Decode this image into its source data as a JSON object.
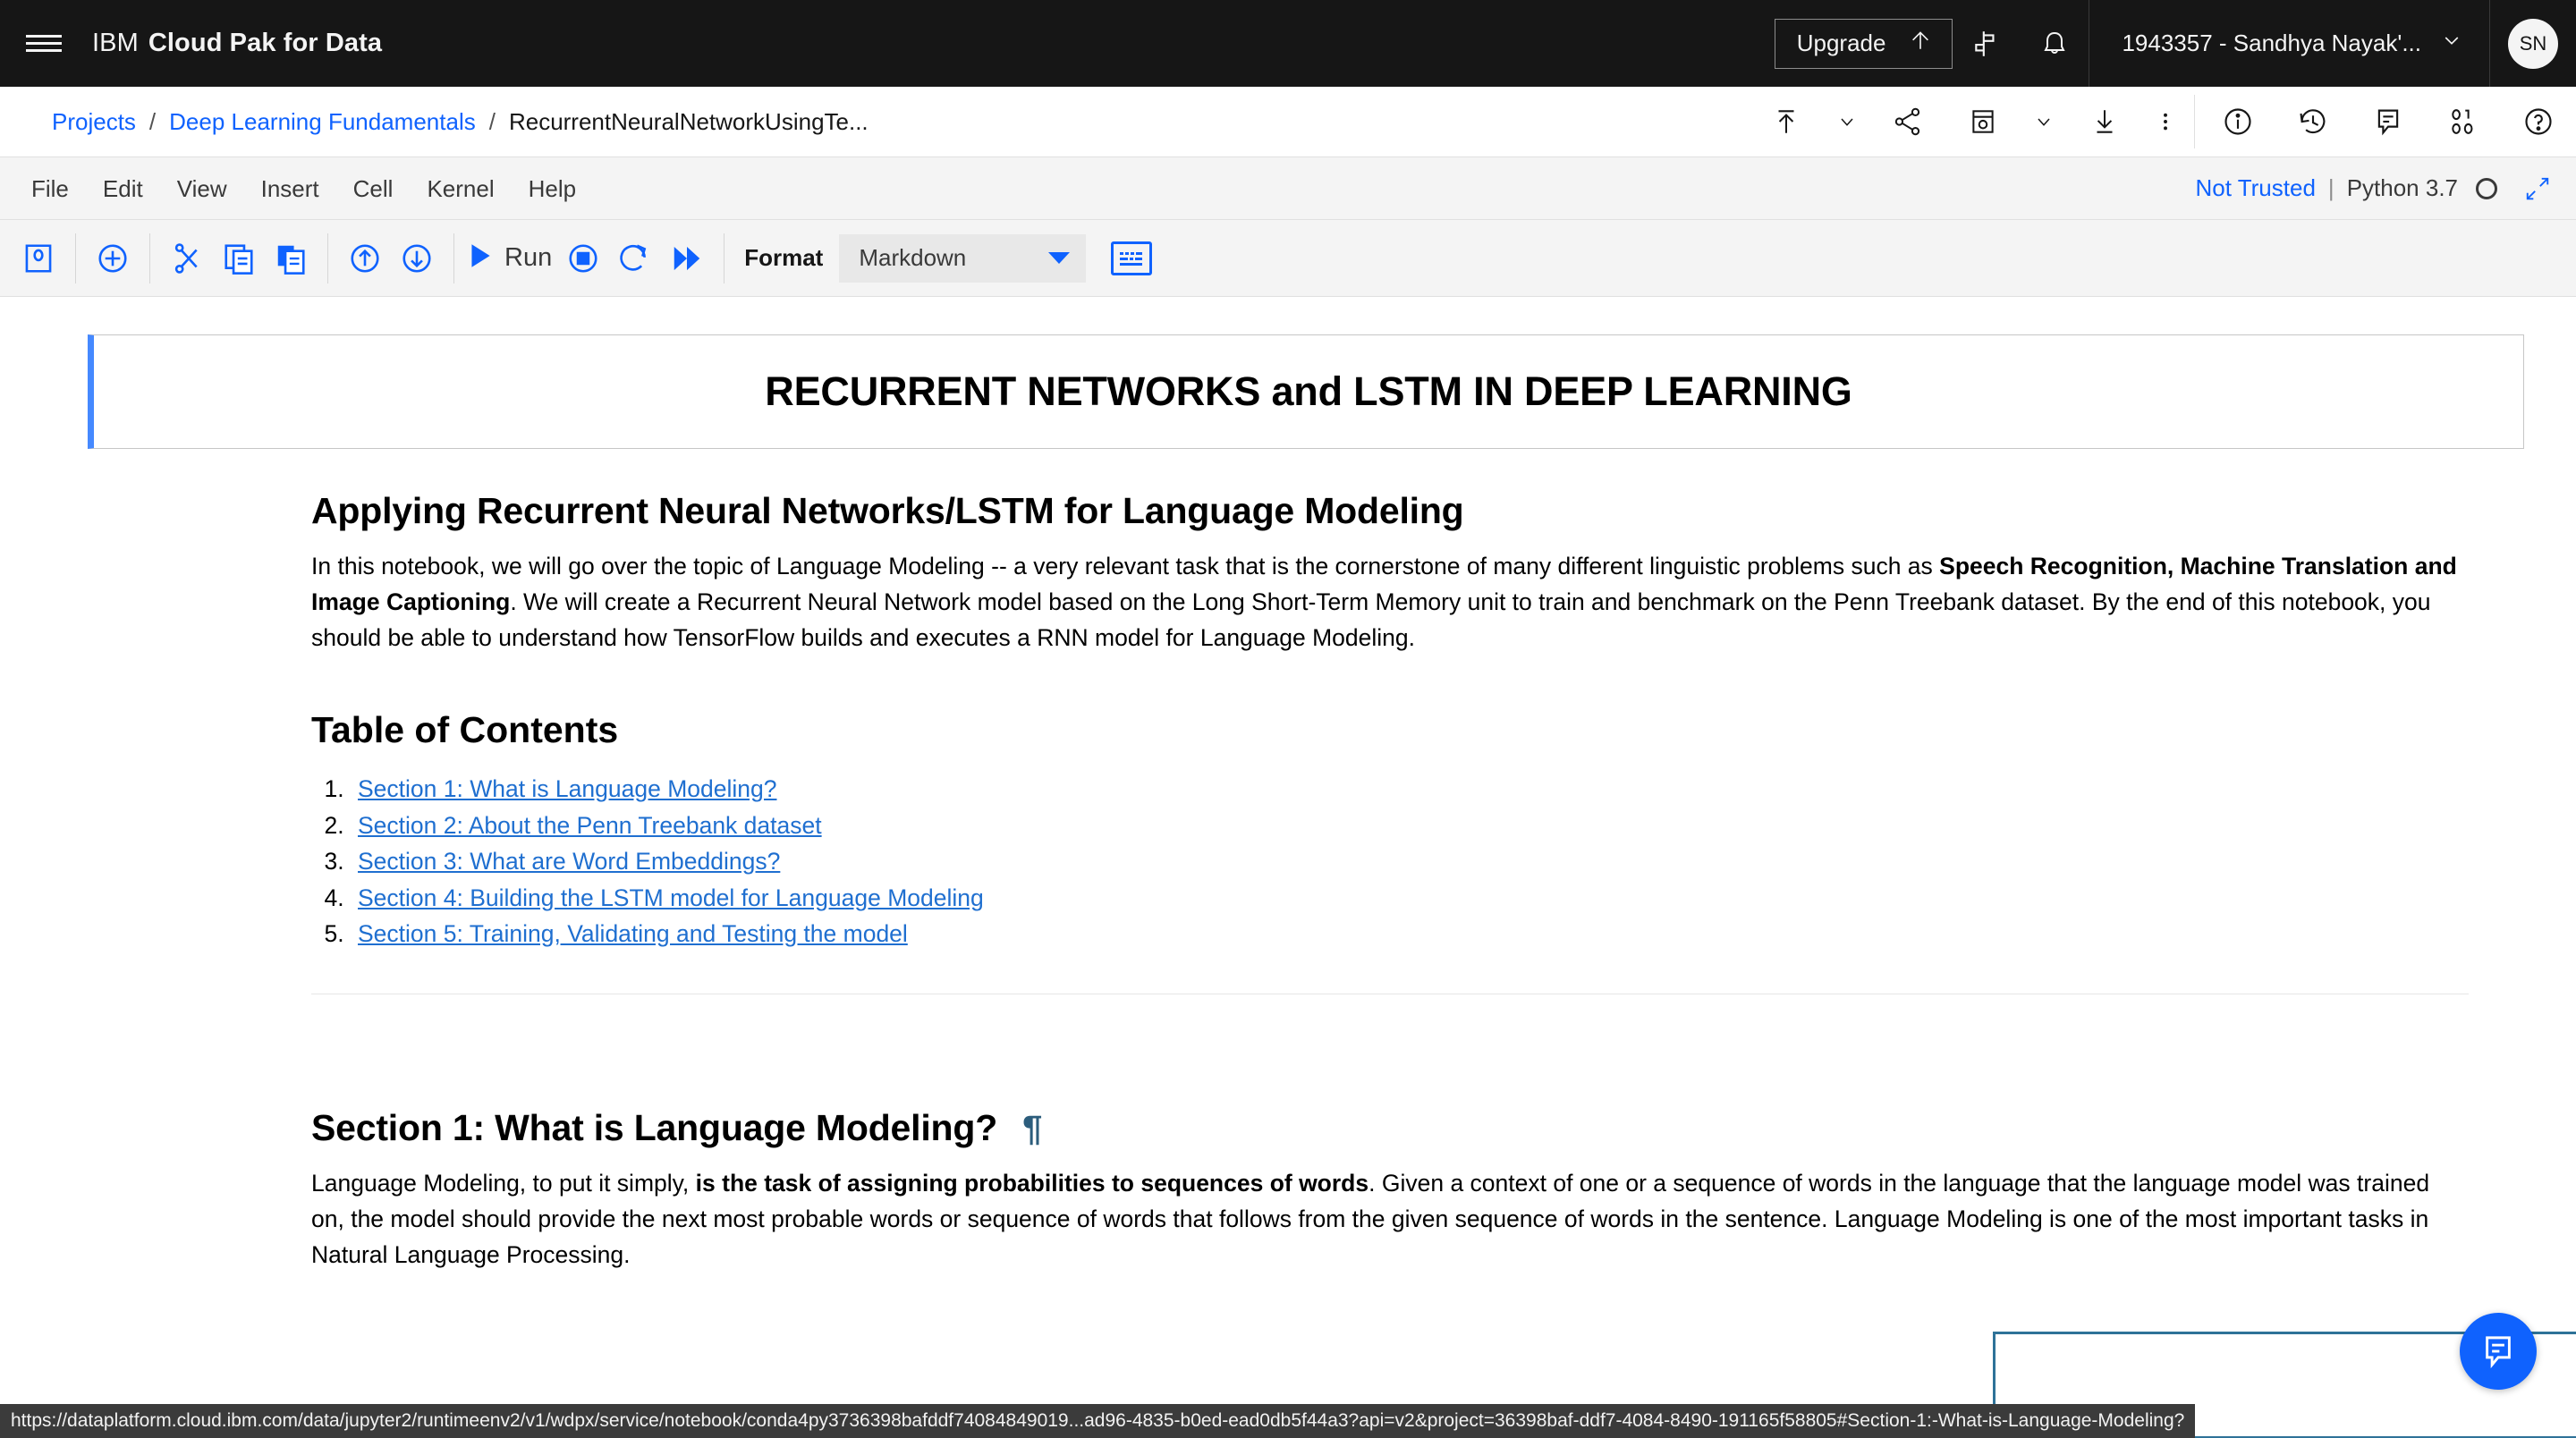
{
  "header": {
    "menu_icon": "hamburger-menu-icon",
    "brand_ibm": "IBM",
    "brand_product": "Cloud Pak for Data",
    "upgrade_label": "Upgrade",
    "upgrade_icon": "arrow-up-icon",
    "switcher_icon": "app-switcher-icon",
    "notification_icon": "bell-icon",
    "account_label": "1943357 - Sandhya Nayak'...",
    "account_chevron": "chevron-down-icon",
    "avatar_initials": "SN"
  },
  "breadcrumb": {
    "items": [
      {
        "label": "Projects",
        "link": true
      },
      {
        "label": "Deep Learning Fundamentals",
        "link": true
      },
      {
        "label": "RecurrentNeuralNetworkUsingTe...",
        "link": false
      }
    ],
    "separator": "/",
    "actions": [
      {
        "name": "publish-icon",
        "glyph": "publish"
      },
      {
        "name": "publish-chevron-down-icon",
        "glyph": "chevron"
      },
      {
        "name": "share-icon",
        "glyph": "share"
      },
      {
        "name": "save-version-icon",
        "glyph": "version"
      },
      {
        "name": "save-version-chevron-down-icon",
        "glyph": "chevron"
      },
      {
        "name": "download-icon",
        "glyph": "download"
      },
      {
        "name": "overflow-menu-icon",
        "glyph": "kebab"
      }
    ],
    "panel_actions": [
      {
        "name": "information-icon",
        "glyph": "info"
      },
      {
        "name": "history-icon",
        "glyph": "history"
      },
      {
        "name": "comments-icon",
        "glyph": "comment"
      },
      {
        "name": "data-binary-icon",
        "glyph": "binary"
      },
      {
        "name": "help-icon",
        "glyph": "help"
      }
    ]
  },
  "notebook_menu": {
    "items": [
      "File",
      "Edit",
      "View",
      "Insert",
      "Cell",
      "Kernel",
      "Help"
    ],
    "trust_status": "Not Trusted",
    "pipe": "|",
    "kernel_name": "Python 3.7",
    "kernel_indicator": "kernel-idle-circle-icon",
    "expand_icon": "expand-collapse-icon"
  },
  "notebook_toolbar": {
    "buttons": [
      {
        "name": "save-checkpoint-button",
        "glyph": "save"
      },
      {
        "name": "insert-cell-below-button",
        "glyph": "plus"
      },
      {
        "name": "cut-cell-button",
        "glyph": "scissors"
      },
      {
        "name": "copy-cell-button",
        "glyph": "copy"
      },
      {
        "name": "paste-cell-button",
        "glyph": "paste"
      },
      {
        "name": "move-cell-up-button",
        "glyph": "arrow-up"
      },
      {
        "name": "move-cell-down-button",
        "glyph": "arrow-down"
      }
    ],
    "run_label": "Run",
    "run_icon": "play-icon",
    "stop_icon": "stop-icon",
    "restart_icon": "restart-icon",
    "restart_run_all_icon": "fast-forward-icon",
    "format_label": "Format",
    "format_value": "Markdown",
    "format_caret": "caret-down-icon",
    "keyboard_icon": "keyboard-shortcuts-icon"
  },
  "notebook": {
    "title_cell": "RECURRENT NETWORKS and LSTM IN DEEP LEARNING",
    "heading_applying": "Applying Recurrent Neural Networks/LSTM for Language Modeling",
    "intro_p1": "In this notebook, we will go over the topic of Language Modeling -- a very relevant task that is the cornerstone of many different linguistic problems such as ",
    "intro_b1": "Speech Recognition, Machine Translation and Image Captioning",
    "intro_p2": ". We will create a Recurrent Neural Network model based on the Long Short-Term Memory unit to train and benchmark on the Penn Treebank dataset. By the end of this notebook, you should be able to understand how TensorFlow builds and executes a RNN model for Language Modeling.",
    "toc_heading": "Table of Contents",
    "toc_items": [
      "Section 1: What is Language Modeling?",
      "Section 2: About the Penn Treebank dataset",
      "Section 3: What are Word Embeddings?",
      "Section 4: Building the LSTM model for Language Modeling",
      "Section 5: Training, Validating and Testing the model"
    ],
    "section1_heading": "Section 1: What is Language Modeling?",
    "section1_anchor": "¶",
    "section1_p1": "Language Modeling, to put it simply, ",
    "section1_b1": "is the task of assigning probabilities to sequences of words",
    "section1_p2": ". Given a context of one or a sequence of words in the language that the language model was trained on, the model should provide the next most probable words or sequence of words that follows from the given sequence of words in the sentence. Language Modeling is one of the most important tasks in Natural Language Processing."
  },
  "chat_fab": {
    "name": "chat-support-icon"
  },
  "status_bar": {
    "url": "https://dataplatform.cloud.ibm.com/data/jupyter2/runtimeenv2/v1/wdpx/service/notebook/conda4py3736398bafddf74084849019...ad96-4835-b0ed-ead0db5f44a3?api=v2&project=36398baf-ddf7-4084-8490-191165f58805#Section-1:-What-is-Language-Modeling?"
  },
  "colors": {
    "header_bg": "#161616",
    "accent_blue": "#0f62fe",
    "link_blue": "#1f6fd0",
    "cell_selected_border": "#4589ff",
    "toolbar_bg": "#f4f4f4"
  }
}
